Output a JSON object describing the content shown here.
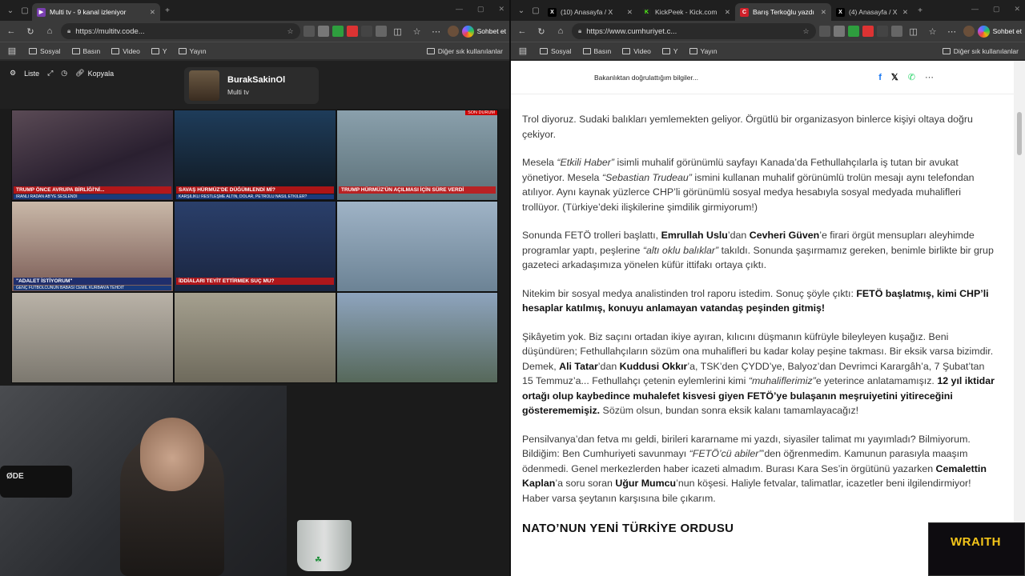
{
  "left_window": {
    "tabs": [
      {
        "label": "Multi tv - 9 kanal izleniyor",
        "active": true
      }
    ],
    "url": "https://multitv.code...",
    "profile_label": "Sohbet et",
    "bookmarks": [
      "Sosyal",
      "Basın",
      "Video",
      "Y",
      "Yayın"
    ],
    "bookmarks_right": "Diğer sık kullanılanlar"
  },
  "multitv": {
    "controls": {
      "list": "Liste",
      "copy": "Kopyala"
    },
    "user_name": "BurakSakinOl",
    "user_sub": "Multi tv",
    "cells": [
      {
        "caption": "TRUMP ÖNCE AVRUPA BİRLİĞİ'Nİ...",
        "sub": "İRANLI RADAN AB'YE SESLENDİ"
      },
      {
        "caption": "SAVAŞ HÜRMÜZ'DE DÜĞÜMLENDİ Mİ?",
        "sub": "KARŞILIKLI RESTLEŞME ALTIN, DOLAR, PETROLÜ NASIL ETKİLER?"
      },
      {
        "caption": "TRUMP HÜRMÜZ'ÜN AÇILMASI İÇİN SÜRE VERDİ",
        "sub": "SON DURUM"
      },
      {
        "caption": "\"ADALET İSTİYORUM\"",
        "sub": "GENÇ FUTBOLCUNUN BABASI CEMİL KURBAN'A TEHDİT"
      },
      {
        "caption": "İDDİALARI TEYİT ETTİRMEK SUÇ MU?",
        "sub": ""
      },
      {
        "caption": "",
        "sub": ""
      },
      {
        "caption": "",
        "sub": ""
      },
      {
        "caption": "",
        "sub": ""
      },
      {
        "caption": "",
        "sub": ""
      }
    ]
  },
  "webcam": {
    "mic_label": "ØDE"
  },
  "right_window": {
    "tabs": [
      {
        "label": "(10) Anasayfa / X",
        "active": false
      },
      {
        "label": "KickPeek - Kick.com",
        "active": false
      },
      {
        "label": "Barış Terkoğlu yazdı",
        "active": true
      },
      {
        "label": "(4) Anasayfa / X",
        "active": false
      }
    ],
    "url": "https://www.cumhuriyet.c...",
    "profile_label": "Sohbet et",
    "bookmarks": [
      "Sosyal",
      "Basın",
      "Video",
      "Y",
      "Yayın"
    ],
    "bookmarks_right": "Diğer sık kullanılanlar"
  },
  "article": {
    "share_text": "Bakanlıktan doğrulattığım bilgiler...",
    "p1": "Trol diyoruz. Sudaki balıkları yemlemekten geliyor. Örgütlü bir organizasyon binlerce kişiyi oltaya doğru çekiyor.",
    "p2a": "Mesela ",
    "p2b": "“Etkili Haber”",
    "p2c": " isimli muhalif görünümlü sayfayı Kanada’da Fethullahçılarla iş tutan bir avukat yönetiyor. Mesela ",
    "p2d": "“Sebastian Trudeau”",
    "p2e": " ismini kullanan muhalif görünümlü trolün mesajı aynı telefondan atılıyor. Aynı kaynak yüzlerce CHP’li görünümlü sosyal medya hesabıyla sosyal medyada muhalifleri trollüyor. (Türkiye’deki ilişkilerine şimdilik girmiyorum!)",
    "p3a": "Sonunda FETÖ trolleri başlattı, ",
    "p3b": "Emrullah Uslu",
    "p3c": "’dan ",
    "p3d": "Cevheri Güven",
    "p3e": "’e firari örgüt mensupları aleyhimde programlar yaptı, peşlerine ",
    "p3f": "“altı oklu balıklar”",
    "p3g": " takıldı. Sonunda şaşırmamız gereken, benimle birlikte bir grup gazeteci arkadaşımıza yönelen küfür ittifakı ortaya çıktı.",
    "p4a": "Nitekim bir sosyal medya analistinden trol raporu istedim. Sonuç şöyle çıktı: ",
    "p4b": "FETÖ başlatmış, kimi CHP’li hesaplar katılmış, konuyu anlamayan vatandaş peşinden gitmiş!",
    "p5a": "Şikâyetim yok. Biz saçını ortadan ikiye ayıran, kılıcını düşmanın küfrüyle bileyleyen kuşağız. Beni düşündüren; Fethullahçıların sözüm ona muhalifleri bu kadar kolay peşine takması. Bir eksik varsa bizimdir. Demek, ",
    "p5b": "Ali Tatar",
    "p5c": "’dan ",
    "p5d": "Kuddusi Okkır",
    "p5e": "’a, TSK’den ÇYDD’ye, Balyoz’dan Devrimci Karargâh’a, 7 Şubat’tan 15 Temmuz’a... Fethullahçı çetenin eylemlerini kimi ",
    "p5f": "“muhaliflerimiz”",
    "p5g": "e yeterince anlatamamışız. ",
    "p5h": "12 yıl iktidar ortağı olup kaybedince muhalefet kisvesi giyen FETÖ’ye bulaşanın meşruiyetini yitireceğini gösterememişiz.",
    "p5i": " Sözüm olsun, bundan sonra eksik kalanı tamamlayacağız!",
    "p6a": "Pensilvanya’dan fetva mı geldi, birileri kararname mi yazdı, siyasiler talimat mı yayımladı? Bilmiyorum. Bildiğim: Ben Cumhuriyeti savunmayı ",
    "p6b": "“FETÖ’cü abiler”",
    "p6c": "’den öğrenmedim. Kamunun parasıyla maaşım ödenmedi. Genel merkezlerden haber icazeti almadım. Burası Kara Ses’in örgütünü yazarken ",
    "p6d": "Cemalettin Kaplan",
    "p6e": "’a soru soran ",
    "p6f": "Uğur Mumcu",
    "p6g": "’nun köşesi. Haliyle fetvalar, talimatlar, icazetler beni ilgilendirmiyor! Haber varsa şeytanın karşısına bile çıkarım.",
    "heading": "NATO’NUN YENİ TÜRKİYE ORDUSU"
  },
  "overlay": {
    "brand": "WRAITH"
  }
}
